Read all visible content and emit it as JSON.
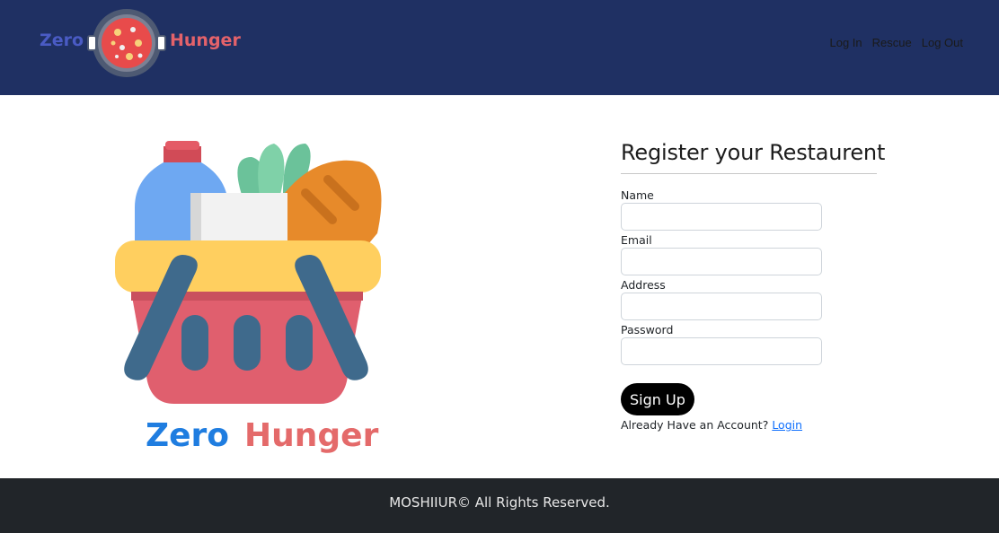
{
  "brand": {
    "word_left": "Zero",
    "word_right": "Hunger",
    "colors": {
      "left": "#4a5bc4",
      "right": "#e4626a"
    }
  },
  "nav": {
    "links": [
      {
        "label": "Log In"
      },
      {
        "label": "Rescue"
      },
      {
        "label": "Log Out"
      }
    ]
  },
  "hero": {
    "caption_left": "Zero",
    "caption_right": "Hunger"
  },
  "form": {
    "title": "Register your Restaurent",
    "fields": [
      {
        "label": "Name",
        "value": "",
        "placeholder": ""
      },
      {
        "label": "Email",
        "value": "",
        "placeholder": ""
      },
      {
        "label": "Address",
        "value": "",
        "placeholder": ""
      },
      {
        "label": "Password",
        "value": "",
        "placeholder": ""
      }
    ],
    "submit_label": "Sign Up",
    "account_prompt": "Already Have an Account?",
    "login_link": "Login"
  },
  "footer": {
    "text": "MOSHIIUR© All Rights Reserved."
  },
  "colors": {
    "navbar_bg": "#1f3063",
    "footer_bg": "#212529",
    "button_bg": "#000000",
    "link": "#0d6efd"
  }
}
